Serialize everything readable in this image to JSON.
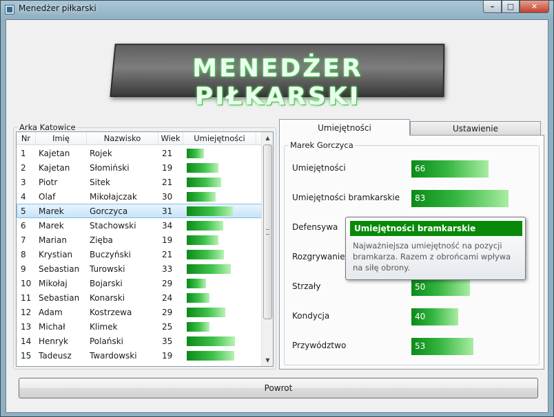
{
  "window": {
    "title": "Menedżer piłkarski"
  },
  "logo": {
    "text": "MENEDŻER PIŁKARSKI"
  },
  "team": {
    "name": "Arka Katowice",
    "columns": [
      "Nr",
      "Imię",
      "Nazwisko",
      "Wiek",
      "Umiejętności"
    ],
    "selected_index": 4,
    "players": [
      {
        "nr": "1",
        "first": "Kajetan",
        "last": "Rojek",
        "age": "21",
        "skill": 36
      },
      {
        "nr": "2",
        "first": "Kajetan",
        "last": "Słomiński",
        "age": "19",
        "skill": 66
      },
      {
        "nr": "3",
        "first": "Piotr",
        "last": "Sitek",
        "age": "21",
        "skill": 71
      },
      {
        "nr": "4",
        "first": "Olaf",
        "last": "Mikołajczak",
        "age": "30",
        "skill": 60
      },
      {
        "nr": "5",
        "first": "Marek",
        "last": "Gorczyca",
        "age": "31",
        "skill": 95
      },
      {
        "nr": "6",
        "first": "Marek",
        "last": "Stachowski",
        "age": "34",
        "skill": 75
      },
      {
        "nr": "7",
        "first": "Marian",
        "last": "Zięba",
        "age": "19",
        "skill": 66
      },
      {
        "nr": "8",
        "first": "Krystian",
        "last": "Buczyński",
        "age": "21",
        "skill": 77
      },
      {
        "nr": "9",
        "first": "Sebastian",
        "last": "Turowski",
        "age": "33",
        "skill": 91
      },
      {
        "nr": "10",
        "first": "Mikołaj",
        "last": "Bojarski",
        "age": "29",
        "skill": 40
      },
      {
        "nr": "11",
        "first": "Sebastian",
        "last": "Konarski",
        "age": "24",
        "skill": 47
      },
      {
        "nr": "12",
        "first": "Adam",
        "last": "Kostrzewa",
        "age": "29",
        "skill": 80
      },
      {
        "nr": "13",
        "first": "Michał",
        "last": "Klimek",
        "age": "25",
        "skill": 47
      },
      {
        "nr": "14",
        "first": "Henryk",
        "last": "Polański",
        "age": "35",
        "skill": 100
      },
      {
        "nr": "15",
        "first": "Tadeusz",
        "last": "Twardowski",
        "age": "19",
        "skill": 99
      }
    ]
  },
  "tabs": [
    {
      "label": "Umiejętności",
      "active": true
    },
    {
      "label": "Ustawienie",
      "active": false
    }
  ],
  "player_detail": {
    "name": "Marek Gorczyca",
    "stats": [
      {
        "label": "Umiejętności",
        "value": "66"
      },
      {
        "label": "Umiejętności bramkarskie",
        "value": "83"
      },
      {
        "label": "Defensywa",
        "value": ""
      },
      {
        "label": "Rozgrywanie",
        "value": ""
      },
      {
        "label": "Strzały",
        "value": "50"
      },
      {
        "label": "Kondycja",
        "value": "40"
      },
      {
        "label": "Przywództwo",
        "value": "53"
      }
    ]
  },
  "tooltip": {
    "title": "Umiejętności bramkarskie",
    "body": "Najważniejsza umiejętność na pozycji bramkarza. Razem z obrońcami wpływa na siłę obrony."
  },
  "back_button": {
    "label": "Powrot"
  },
  "colors": {
    "bar_green": "#0b8a18",
    "tooltip_header": "#088a08",
    "selection": "#c6e4f9"
  }
}
